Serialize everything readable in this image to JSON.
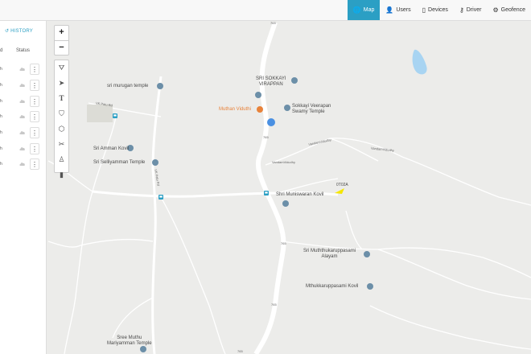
{
  "nav": {
    "items": [
      {
        "label": "Map",
        "icon": "globe-icon",
        "active": true
      },
      {
        "label": "Users",
        "icon": "user-icon",
        "active": false
      },
      {
        "label": "Devices",
        "icon": "mobile-icon",
        "active": false
      },
      {
        "label": "Driver",
        "icon": "key-icon",
        "active": false
      },
      {
        "label": "Geofence",
        "icon": "gear-icon",
        "active": false
      }
    ]
  },
  "panel": {
    "history_label": "HISTORY",
    "col_d": "d",
    "col_status": "Status",
    "rows": [
      "h",
      "h",
      "h",
      "h",
      "h",
      "h",
      "h"
    ]
  },
  "map": {
    "zoom_in": "+",
    "zoom_out": "−",
    "vehicle_label": "0T02A",
    "pois": {
      "murugan": "sri murugan temple",
      "sokkayi": "SRI SOKKAYI\nVIRAPPAN",
      "muthan": "Muthan Viduthi",
      "sokkayi_veerapan": "Sokkayi Veerapan\nSwamy Temple",
      "amman": "Sri Amman Kovil",
      "selliyamman": "Sri Selliyamman Temple",
      "muniswaran": "Shri Muniswaran Kovil",
      "muththukaruppasami": "Sri Muththukaruppasami\nAlayam",
      "mthukkaruppasami": "Mthukkaruppasami Kovil",
      "muthu_mariyamman": "Sree Muthu\nMariyamman Temple"
    },
    "road_labels": {
      "r1": "765",
      "r2": "765",
      "r3": "765",
      "r4": "765",
      "r5": "765",
      "vaidun": "VandamVidudhy",
      "vaidun2": "VandamVidudhy",
      "vaidun3": "VandamVidudhy",
      "pats1": "VK Patu Rd",
      "pats2": "VK Patu Rd"
    },
    "colors": {
      "accent": "#2b9fc4",
      "road": "#ffffff",
      "water": "#a8d4f2",
      "vehicle": "#f5e600",
      "poi": "#6c8fa8"
    }
  }
}
